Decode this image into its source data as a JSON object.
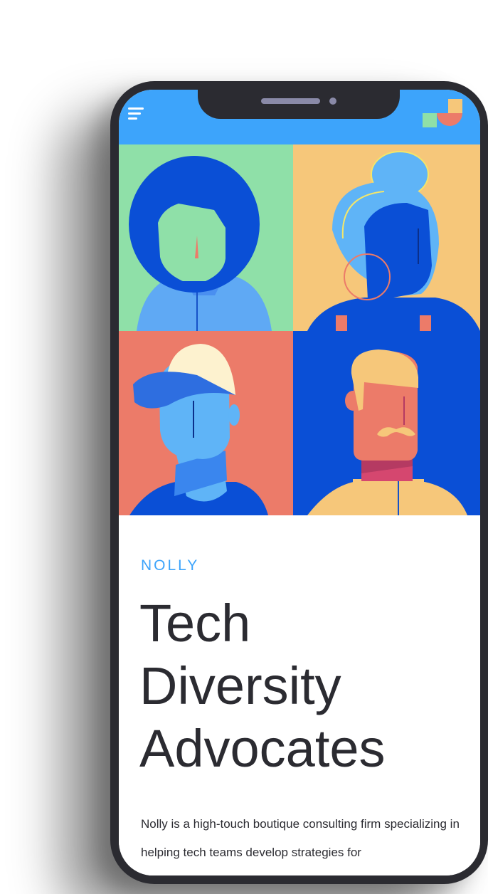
{
  "app": {
    "menu_icon": "hamburger-menu-icon",
    "logo_icon": "nolly-logo-icon",
    "colors": {
      "primary_blue": "#3da4fb",
      "dark_blue": "#0a4fd6",
      "mint": "#8fe0a8",
      "sand": "#f6c77a",
      "coral": "#ec7b69",
      "text": "#2b2b31"
    }
  },
  "hero": {
    "portraits": [
      "woman-bob-hair",
      "woman-hair-bun",
      "man-cap",
      "man-mustache"
    ]
  },
  "content": {
    "brand": "NOLLY",
    "headline": "Tech Diversity Advocates",
    "body": "Nolly is a high-touch boutique consulting firm specializing in helping tech teams develop strategies for"
  }
}
